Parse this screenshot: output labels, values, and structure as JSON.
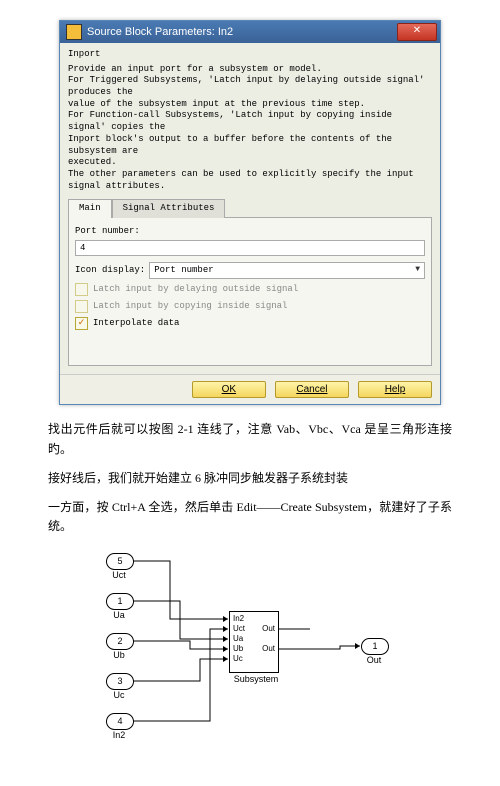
{
  "dialog": {
    "title": "Source Block Parameters: In2",
    "close_glyph": "✕",
    "section": "Inport",
    "description": "Provide an input port for a subsystem or model.\nFor Triggered Subsystems, 'Latch input by delaying outside signal' produces the\nvalue of the subsystem input at the previous time step.\nFor Function-call Subsystems, 'Latch input by copying inside signal' copies the\nInport block's output to a buffer before the contents of the subsystem are\nexecuted.\nThe other parameters can be used to explicitly specify the input signal attributes.",
    "tabs": {
      "main": "Main",
      "signal": "Signal Attributes"
    },
    "port_number_label": "Port number:",
    "port_number_value": "4",
    "icon_display_label": "Icon display:",
    "icon_display_value": "Port number",
    "check_latch_delay": "Latch input by delaying outside signal",
    "check_latch_copy": "Latch input by copying inside signal",
    "check_interp": "Interpolate data",
    "buttons": {
      "ok": "OK",
      "cancel": "Cancel",
      "help": "Help"
    }
  },
  "text": {
    "p1": "找出元件后就可以按图 2-1 连线了，注意 Vab、Vbc、Vca 是呈三角形连接旳。",
    "p2": "接好线后，我们就开始建立 6 脉冲同步触发器子系统封装",
    "p3": "一方面，按 Ctrl+A 全选，然后单击 Edit——Create Subsystem，就建好了子系统。"
  },
  "diagram": {
    "ports_in": [
      {
        "num": "5",
        "label": "Uct"
      },
      {
        "num": "1",
        "label": "Ua"
      },
      {
        "num": "2",
        "label": "Ub"
      },
      {
        "num": "3",
        "label": "Uc"
      },
      {
        "num": "4",
        "label": "In2"
      }
    ],
    "subsystem": {
      "inputs": [
        "In2",
        "Uct",
        "Ua",
        "Ub",
        "Uc"
      ],
      "outputs": [
        "Out",
        "Out"
      ],
      "label": "Subsystem"
    },
    "port_out": {
      "num": "1",
      "label": "Out"
    }
  }
}
